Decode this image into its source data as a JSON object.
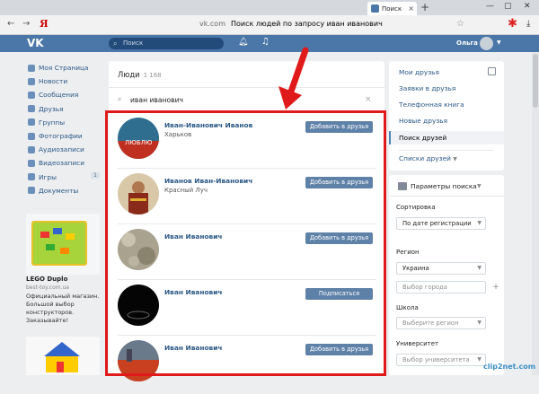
{
  "browser": {
    "tab_title": "Поиск",
    "url_domain": "vk.com",
    "page_title": "Поиск людей по запросу иван иванович",
    "yandex_logo": "Я"
  },
  "header": {
    "logo": "VK",
    "search_placeholder": "Поиск",
    "user_name": "Ольга"
  },
  "sidebar": {
    "items": [
      {
        "label": "Моя Страница"
      },
      {
        "label": "Новости"
      },
      {
        "label": "Сообщения"
      },
      {
        "label": "Друзья"
      },
      {
        "label": "Группы"
      },
      {
        "label": "Фотографии"
      },
      {
        "label": "Аудиозаписи"
      },
      {
        "label": "Видеозаписи"
      },
      {
        "label": "Игры",
        "badge": "1"
      },
      {
        "label": "Документы"
      }
    ]
  },
  "ad": {
    "title": "LEGO Duplo",
    "url": "best-toy.com.ua",
    "text": "Официальный магазин. Большой выбор конструкторов. Заказывайте!"
  },
  "main": {
    "title": "Люди",
    "count": "1 168",
    "query": "иван иванович",
    "results": [
      {
        "name": "Иван-Иванович Иванов",
        "city": "Харьков",
        "button": "Добавить в друзья"
      },
      {
        "name": "Иванов Иван-Иванович",
        "city": "Красный Луч",
        "button": "Добавить в друзья"
      },
      {
        "name": "Иван Иванович",
        "city": "",
        "button": "Добавить в друзья"
      },
      {
        "name": "Иван Иванович",
        "city": "",
        "button": "Подписаться"
      },
      {
        "name": "Иван Иванович",
        "city": "",
        "button": "Добавить в друзья"
      }
    ]
  },
  "right_menu": {
    "items": [
      "Мои друзья",
      "Заявки в друзья",
      "Телефонная книга",
      "Новые друзья",
      "Поиск друзей",
      "Списки друзей"
    ]
  },
  "params": {
    "header": "Параметры поиска",
    "sort_label": "Сортировка",
    "sort_value": "По дате регистрации",
    "region_label": "Регион",
    "country": "Украина",
    "city_placeholder": "Выбор города",
    "school_label": "Школа",
    "school_placeholder": "Выберите регион",
    "uni_label": "Университет",
    "uni_placeholder": "Выбор университета"
  },
  "watermark": "clip2net.com",
  "colors": {
    "vk_blue": "#4a76a8",
    "highlight_red": "#e01a1a",
    "link": "#2a5885",
    "button": "#5e81a8"
  }
}
